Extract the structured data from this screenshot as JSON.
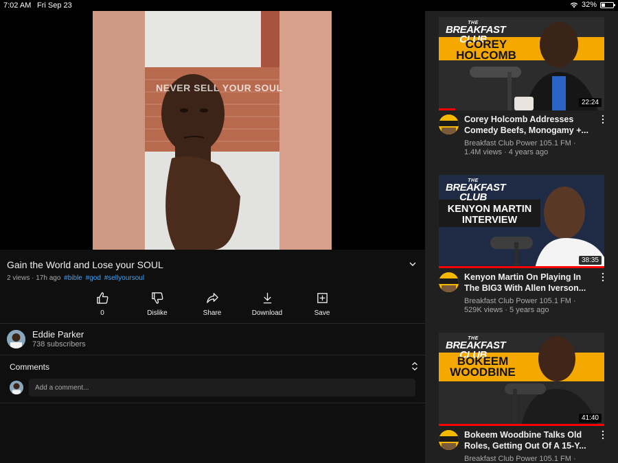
{
  "status_bar": {
    "time": "7:02 AM",
    "date": "Fri Sep 23",
    "battery": "32%",
    "battery_level": 0.32
  },
  "player": {
    "overlay_text": "NEVER SELL YOUR SOUL",
    "played_fraction": 0.06,
    "buffered_fraction": 0.135
  },
  "video": {
    "title": "Gain the World and Lose your SOUL",
    "meta": "2 views · 17h ago",
    "hashtags": [
      "#bible",
      "#god",
      "#sellyoursoul"
    ]
  },
  "actions": {
    "like_count": "0",
    "dislike": "Dislike",
    "share": "Share",
    "download": "Download",
    "save": "Save"
  },
  "channel": {
    "name": "Eddie Parker",
    "subscribers": "738 subscribers"
  },
  "comments": {
    "heading": "Comments",
    "placeholder": "Add a comment..."
  },
  "sidebar": {
    "cards": [
      {
        "logo_top": "THE",
        "logo_main": "BREAKFAST CLUB",
        "plate": [
          "COREY",
          "HOLCOMB"
        ],
        "duration": "22:24",
        "title_1": "Corey Holcomb Addresses",
        "title_2": "Comedy Beefs, Monogamy +...",
        "channel": "Breakfast Club Power 105.1 FM ·",
        "stats": "1.4M views · 4 years ago",
        "watched_fraction": 0.1
      },
      {
        "logo_top": "THE",
        "logo_main": "BREAKFAST CLUB",
        "plate": [
          "KENYON MARTIN",
          "INTERVIEW"
        ],
        "duration": "38:35",
        "title_1": "Kenyon Martin On Playing In",
        "title_2": "The BIG3 With Allen Iverson...",
        "channel": "Breakfast Club Power 105.1 FM ·",
        "stats": "529K views · 5 years ago",
        "watched_fraction": 1.0
      },
      {
        "logo_top": "THE",
        "logo_main": "BREAKFAST CLUB",
        "plate": [
          "BOKEEM",
          "WOODBINE"
        ],
        "duration": "41:40",
        "title_1": "Bokeem Woodbine Talks Old",
        "title_2": "Roles, Getting Out Of A 15-Y...",
        "channel": "Breakfast Club Power 105.1 FM ·",
        "stats": "",
        "watched_fraction": 1.0
      }
    ]
  },
  "colors": {
    "accent": "#ff0000",
    "link": "#3ea6ff",
    "plate_yellow": "#f5a800"
  }
}
